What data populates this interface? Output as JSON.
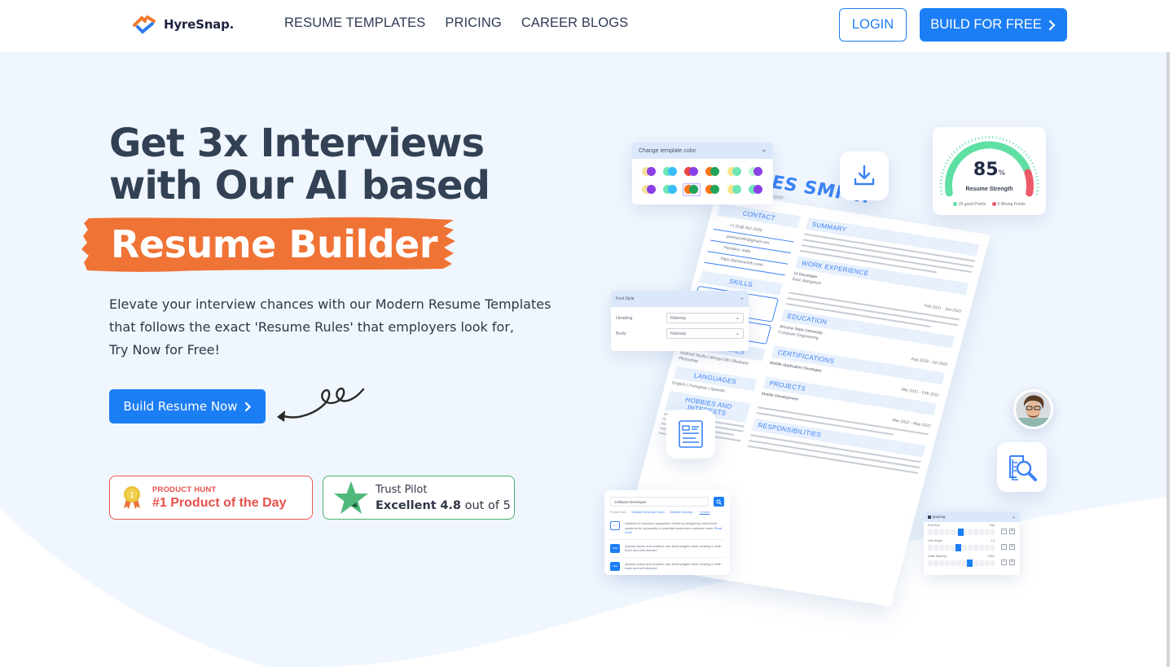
{
  "nav": {
    "brand": "HyreSnap.",
    "links": [
      "RESUME TEMPLATES",
      "PRICING",
      "CAREER BLOGS"
    ],
    "login_label": "LOGIN",
    "build_free_label": "BUILD FOR FREE"
  },
  "hero": {
    "headline_line1": "Get 3x Interviews",
    "headline_line2": "with Our AI based",
    "highlight": "Resume Builder",
    "subtitle_line1": "Elevate your interview chances with our Modern Resume Templates",
    "subtitle_line2": "that follows the exact 'Resume Rules' that employers look for,",
    "subtitle_line3": "Try Now for Free!",
    "cta_label": "Build Resume Now"
  },
  "badges": {
    "product_hunt": {
      "medal_number": "1",
      "label": "PRODUCT HUNT",
      "title": "#1 Product of the Day"
    },
    "trust_pilot": {
      "label": "Trust Pilot",
      "rating_word": "Excellent",
      "rating": "4.8",
      "suffix": "out of 5"
    }
  },
  "illustration": {
    "template_color": {
      "title": "Change template color",
      "swatches": [
        [
          "#f6e39a",
          "#8b3fe6"
        ],
        [
          "#6ee7b7",
          "#38bdf8"
        ],
        [
          "#ef4444",
          "#8b3fe6"
        ],
        [
          "#f97316",
          "#22a35a"
        ],
        [
          "#fde68a",
          "#6ee7b7"
        ],
        [
          "#bbf7d0",
          "#8b3fe6"
        ],
        [
          "#f6e39a",
          "#8b3fe6"
        ],
        [
          "#6ee7b7",
          "#38bdf8"
        ],
        [
          "#f97316",
          "#22a35a"
        ],
        [
          "#f97316",
          "#22a35a"
        ],
        [
          "#fde68a",
          "#6ee7b7"
        ],
        [
          "#6ee7b7",
          "#8b3fe6"
        ]
      ],
      "selected_index": 8
    },
    "strength": {
      "score": "85",
      "unit": "%",
      "label": "Resume Strength",
      "score_fraction": 0.85,
      "good_points": "39 good Points",
      "wrong_points": "6 Wrong Points",
      "good_color": "#5ee0a3",
      "wrong_color": "#ec5a6a"
    },
    "font_style": {
      "title": "Font Style",
      "rows": [
        {
          "label": "Heading",
          "value": "Raleway"
        },
        {
          "label": "Body",
          "value": "Raleway"
        }
      ]
    },
    "resume": {
      "name": "JAMES SMITH",
      "role": "Application Developer",
      "contact_title": "CONTACT",
      "contact": [
        "+1 (0)@ 8x2-2030",
        "jamessmith@gmail.com",
        "Patnakot, India",
        "https://jamessmith.com/"
      ],
      "skills_title": "SKILLS",
      "softwares_title": "SOFTWARES",
      "softwares": "Android Studio | Mongo DB | Illustrator Photoshop",
      "languages_title": "LANGUAGES",
      "languages": "English | Portugese | Spanish",
      "hobbies_title": "HOBBIES AND INTERESTS",
      "summary_title": "SUMMARY",
      "work_title": "WORK EXPERIENCE",
      "work_role": "UI Developer",
      "work_company": "Dazl, Bangalore",
      "work_dates": "Feb 2021 - Jun 2022",
      "education_title": "EDUCATION",
      "education_school": "Arizona State University",
      "education_degree": "Computer Engineering",
      "education_dates": "Aug 2018 - Jul 2020",
      "certifications_title": "CERTIFICATIONS",
      "cert_name": "Mobile Application Developer",
      "cert_dates": "Mar 2021 - Feb 2022",
      "projects_title": "PROJECTS",
      "project_name": "Mobile Development",
      "project_dates": "Mar 2022 - May 2022",
      "responsibilities_title": "RESPONSIBILITIES"
    },
    "search_card": {
      "query": "Software Developer",
      "suggestions_label": "Popular titles",
      "chips": [
        "Software Developer Intern",
        "Software Develop..."
      ],
      "more": "+2 more",
      "items": [
        {
          "tag": "—",
          "text": "Assisted in business acquisition efforts by designing customized solutions for proposals to potential customers customer custo",
          "link": "Read more"
        },
        {
          "tag": "ADD",
          "text": "Quickly learns and masters new technologies while working in both team and self-directed"
        },
        {
          "tag": "ADD",
          "text": "Quickly learns and masters new technologies while working in both team and self-directed"
        }
      ]
    },
    "spacing": {
      "title": "Spacing",
      "rows": [
        {
          "label": "Font Size",
          "value": "11pt",
          "level": 0.45
        },
        {
          "label": "Line Height",
          "value": "1.3",
          "level": 0.42
        },
        {
          "label": "Letter Spacing",
          "value": "0.5px",
          "level": 0.58
        }
      ]
    }
  }
}
